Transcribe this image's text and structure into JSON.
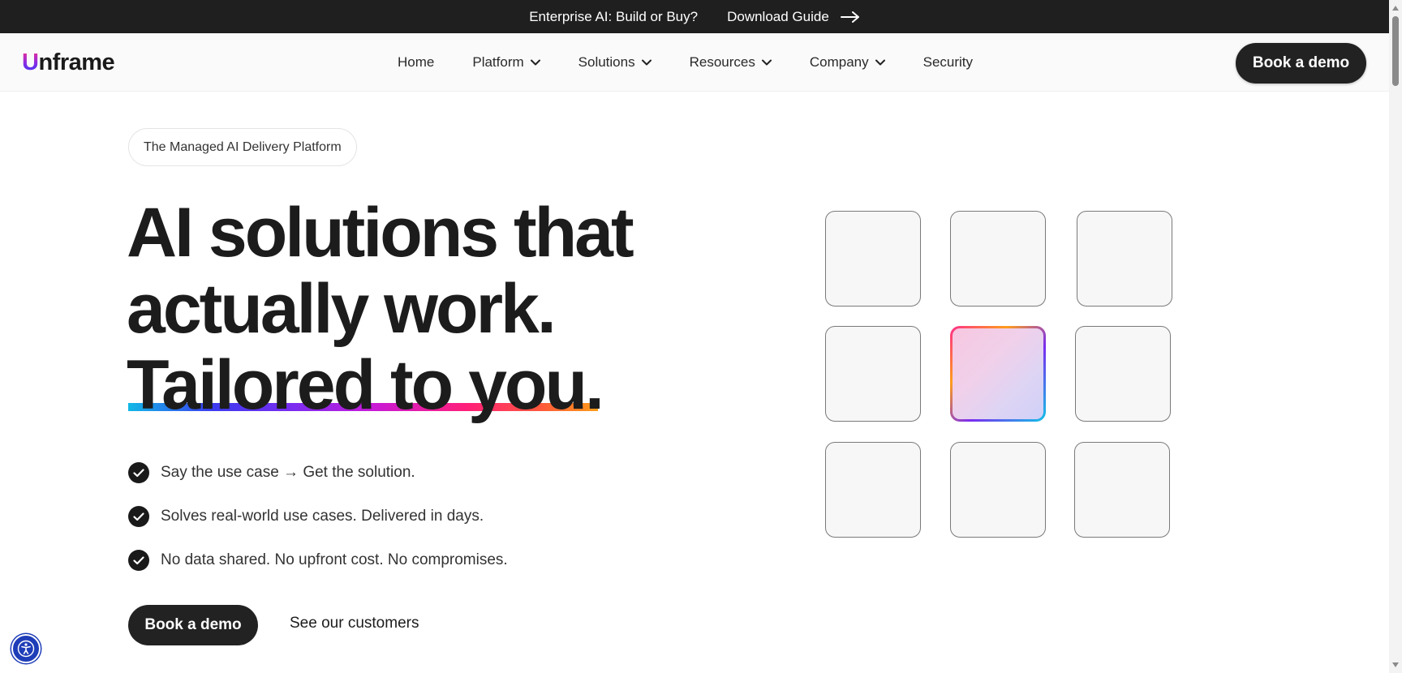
{
  "announcement": {
    "text": "Enterprise AI: Build or Buy?",
    "link_label": "Download Guide",
    "link_icon": "arrow-right-icon"
  },
  "nav": {
    "logo_first": "U",
    "logo_rest": "nframe",
    "items": [
      {
        "label": "Home",
        "dropdown": false
      },
      {
        "label": "Platform",
        "dropdown": true
      },
      {
        "label": "Solutions",
        "dropdown": true
      },
      {
        "label": "Resources",
        "dropdown": true
      },
      {
        "label": "Company",
        "dropdown": true
      },
      {
        "label": "Security",
        "dropdown": false
      }
    ],
    "cta_label": "Book a demo"
  },
  "hero": {
    "eyebrow": "The Managed AI Delivery Platform",
    "headline_lines": [
      "AI solutions that",
      "actually work.",
      "Tailored to you."
    ],
    "checks": [
      "Say the use case → Get the solution.",
      "Solves real-world use cases. Delivered in days.",
      "No data shared. No upfront cost. No compromises."
    ],
    "cta_label": "Book a demo",
    "secondary_label": "See our customers"
  },
  "tile_grid": {
    "rows": 3,
    "cols": 3,
    "active_index": 4
  },
  "colors": {
    "dark": "#1f1f1f",
    "accent_gradient": [
      "#11b8e6",
      "#3b3bf0",
      "#7a2cf0",
      "#c81ad8",
      "#ff1f7a",
      "#ff9d1a"
    ],
    "a11y_blue": "#1e3db8"
  },
  "accessibility_button": {
    "icon": "accessibility-icon"
  }
}
